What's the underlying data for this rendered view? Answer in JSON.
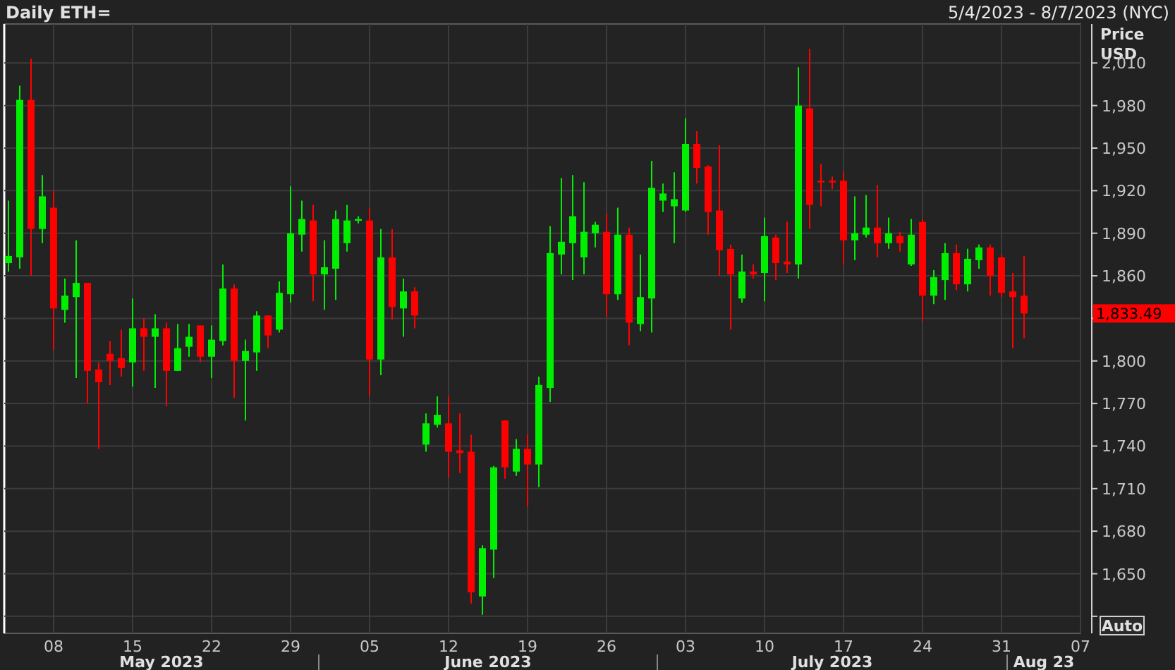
{
  "header": {
    "title": "Daily ETH=",
    "date_range": "5/4/2023 - 8/7/2023 (NYC)"
  },
  "price_axis": {
    "title": "Price",
    "unit": "USD",
    "last_price": "1,833.49",
    "auto_button": "Auto"
  },
  "months": [
    "May 2023",
    "June 2023",
    "July 2023",
    "Aug 23"
  ],
  "chart_data": {
    "type": "candlestick",
    "xlim": [
      "2023-05-04",
      "2023-08-07"
    ],
    "ylim": [
      1608,
      2037.5
    ],
    "yticks": [
      {
        "value": 2010,
        "label": "2,010"
      },
      {
        "value": 1980,
        "label": "1,980"
      },
      {
        "value": 1950,
        "label": "1,950"
      },
      {
        "value": 1920,
        "label": "1,920"
      },
      {
        "value": 1890,
        "label": "1,890"
      },
      {
        "value": 1860,
        "label": "1,860"
      },
      {
        "value": 1800,
        "label": "1,800"
      },
      {
        "value": 1770,
        "label": "1,770"
      },
      {
        "value": 1740,
        "label": "1,740"
      },
      {
        "value": 1710,
        "label": "1,710"
      },
      {
        "value": 1680,
        "label": "1,680"
      },
      {
        "value": 1650,
        "label": "1,650"
      }
    ],
    "xticks": [
      {
        "value": "2023-05-08",
        "label": "08"
      },
      {
        "value": "2023-05-15",
        "label": "15"
      },
      {
        "value": "2023-05-22",
        "label": "22"
      },
      {
        "value": "2023-05-29",
        "label": "29"
      },
      {
        "value": "2023-06-05",
        "label": "05"
      },
      {
        "value": "2023-06-12",
        "label": "12"
      },
      {
        "value": "2023-06-19",
        "label": "19"
      },
      {
        "value": "2023-06-26",
        "label": "26"
      },
      {
        "value": "2023-07-03",
        "label": "03"
      },
      {
        "value": "2023-07-10",
        "label": "10"
      },
      {
        "value": "2023-07-17",
        "label": "17"
      },
      {
        "value": "2023-07-24",
        "label": "24"
      },
      {
        "value": "2023-07-31",
        "label": "31"
      },
      {
        "value": "2023-08-07",
        "label": "07"
      }
    ],
    "x": [
      "2023-05-04",
      "2023-05-05",
      "2023-05-06",
      "2023-05-07",
      "2023-05-08",
      "2023-05-09",
      "2023-05-10",
      "2023-05-11",
      "2023-05-12",
      "2023-05-13",
      "2023-05-14",
      "2023-05-15",
      "2023-05-16",
      "2023-05-17",
      "2023-05-18",
      "2023-05-19",
      "2023-05-20",
      "2023-05-21",
      "2023-05-22",
      "2023-05-23",
      "2023-05-24",
      "2023-05-25",
      "2023-05-26",
      "2023-05-27",
      "2023-05-28",
      "2023-05-29",
      "2023-05-30",
      "2023-05-31",
      "2023-06-01",
      "2023-06-02",
      "2023-06-03",
      "2023-06-04",
      "2023-06-05",
      "2023-06-06",
      "2023-06-07",
      "2023-06-08",
      "2023-06-09",
      "2023-06-10",
      "2023-06-11",
      "2023-06-12",
      "2023-06-13",
      "2023-06-14",
      "2023-06-15",
      "2023-06-16",
      "2023-06-17",
      "2023-06-18",
      "2023-06-19",
      "2023-06-20",
      "2023-06-21",
      "2023-06-22",
      "2023-06-23",
      "2023-06-24",
      "2023-06-25",
      "2023-06-26",
      "2023-06-27",
      "2023-06-28",
      "2023-06-29",
      "2023-06-30",
      "2023-07-01",
      "2023-07-02",
      "2023-07-03",
      "2023-07-04",
      "2023-07-05",
      "2023-07-06",
      "2023-07-07",
      "2023-07-08",
      "2023-07-09",
      "2023-07-10",
      "2023-07-11",
      "2023-07-12",
      "2023-07-13",
      "2023-07-14",
      "2023-07-15",
      "2023-07-16",
      "2023-07-17",
      "2023-07-18",
      "2023-07-19",
      "2023-07-20",
      "2023-07-21",
      "2023-07-22",
      "2023-07-23",
      "2023-07-24",
      "2023-07-25",
      "2023-07-26",
      "2023-07-27",
      "2023-07-28",
      "2023-07-29",
      "2023-07-30",
      "2023-07-31",
      "2023-08-01",
      "2023-08-02"
    ],
    "ohlc": [
      [
        1869,
        1913,
        1863,
        1874
      ],
      [
        1873,
        1994,
        1865,
        1984
      ],
      [
        1984,
        2013,
        1860,
        1893
      ],
      [
        1893,
        1931,
        1883,
        1916
      ],
      [
        1908,
        1920,
        1808,
        1837
      ],
      [
        1836,
        1858,
        1827,
        1846
      ],
      [
        1845,
        1885,
        1788,
        1855
      ],
      [
        1855,
        1855,
        1770,
        1793
      ],
      [
        1794,
        1799,
        1738,
        1785
      ],
      [
        1805,
        1814,
        1783,
        1800
      ],
      [
        1802,
        1822,
        1789,
        1795
      ],
      [
        1799,
        1844,
        1782,
        1823
      ],
      [
        1823,
        1830,
        1793,
        1817
      ],
      [
        1817,
        1833,
        1781,
        1823
      ],
      [
        1823,
        1827,
        1768,
        1793
      ],
      [
        1793,
        1826,
        1793,
        1809
      ],
      [
        1810,
        1826,
        1803,
        1817
      ],
      [
        1825,
        1825,
        1799,
        1803
      ],
      [
        1803,
        1825,
        1788,
        1815
      ],
      [
        1814,
        1868,
        1811,
        1851
      ],
      [
        1851,
        1854,
        1774,
        1800
      ],
      [
        1800,
        1815,
        1758,
        1807
      ],
      [
        1806,
        1835,
        1793,
        1832
      ],
      [
        1832,
        1832,
        1809,
        1818
      ],
      [
        1822,
        1856,
        1820,
        1848
      ],
      [
        1847,
        1923,
        1841,
        1890
      ],
      [
        1889,
        1913,
        1877,
        1900
      ],
      [
        1899,
        1910,
        1842,
        1861
      ],
      [
        1861,
        1885,
        1836,
        1866
      ],
      [
        1865,
        1906,
        1843,
        1900
      ],
      [
        1883,
        1910,
        1877,
        1899
      ],
      [
        1899,
        1902,
        1897,
        1900
      ],
      [
        1899,
        1908,
        1775,
        1801
      ],
      [
        1801,
        1893,
        1790,
        1873
      ],
      [
        1873,
        1893,
        1829,
        1838
      ],
      [
        1837,
        1858,
        1817,
        1849
      ],
      [
        1849,
        1852,
        1823,
        1832
      ],
      [
        1741,
        1763,
        1736,
        1756
      ],
      [
        1755,
        1775,
        1753,
        1762
      ],
      [
        1756,
        1775,
        1718,
        1736
      ],
      [
        1737,
        1763,
        1721,
        1735
      ],
      [
        1736,
        1748,
        1629,
        1637
      ],
      [
        1634,
        1670,
        1621,
        1668
      ],
      [
        1667,
        1726,
        1647,
        1725
      ],
      [
        1758,
        1758,
        1717,
        1725
      ],
      [
        1722,
        1745,
        1719,
        1738
      ],
      [
        1738,
        1748,
        1697,
        1727
      ],
      [
        1727,
        1789,
        1711,
        1783
      ],
      [
        1781,
        1895,
        1771,
        1876
      ],
      [
        1875,
        1929,
        1861,
        1884
      ],
      [
        1883,
        1931,
        1857,
        1902
      ],
      [
        1873,
        1926,
        1861,
        1891
      ],
      [
        1890,
        1898,
        1880,
        1896
      ],
      [
        1891,
        1904,
        1831,
        1847
      ],
      [
        1847,
        1908,
        1843,
        1889
      ],
      [
        1889,
        1894,
        1811,
        1827
      ],
      [
        1826,
        1875,
        1821,
        1845
      ],
      [
        1844,
        1941,
        1820,
        1922
      ],
      [
        1913,
        1925,
        1905,
        1918
      ],
      [
        1909,
        1933,
        1883,
        1914
      ],
      [
        1906,
        1971,
        1905,
        1953
      ],
      [
        1953,
        1962,
        1925,
        1936
      ],
      [
        1937,
        1938,
        1889,
        1905
      ],
      [
        1906,
        1952,
        1860,
        1878
      ],
      [
        1879,
        1882,
        1822,
        1861
      ],
      [
        1844,
        1875,
        1841,
        1863
      ],
      [
        1863,
        1868,
        1858,
        1861
      ],
      [
        1862,
        1901,
        1842,
        1888
      ],
      [
        1887,
        1889,
        1857,
        1869
      ],
      [
        1870,
        1898,
        1862,
        1868
      ],
      [
        1868,
        2007,
        1858,
        1980
      ],
      [
        1978,
        2020,
        1893,
        1910
      ],
      [
        1927,
        1939,
        1909,
        1926
      ],
      [
        1927,
        1930,
        1921,
        1926
      ],
      [
        1927,
        1933,
        1868,
        1885
      ],
      [
        1885,
        1916,
        1871,
        1890
      ],
      [
        1889,
        1917,
        1887,
        1894
      ],
      [
        1894,
        1924,
        1873,
        1883
      ],
      [
        1883,
        1901,
        1879,
        1890
      ],
      [
        1888,
        1891,
        1877,
        1883
      ],
      [
        1868,
        1900,
        1867,
        1889
      ],
      [
        1898,
        1900,
        1828,
        1846
      ],
      [
        1846,
        1864,
        1840,
        1859
      ],
      [
        1857,
        1883,
        1843,
        1876
      ],
      [
        1876,
        1882,
        1850,
        1854
      ],
      [
        1854,
        1879,
        1849,
        1872
      ],
      [
        1871,
        1882,
        1865,
        1880
      ],
      [
        1880,
        1882,
        1846,
        1860
      ],
      [
        1873,
        1875,
        1845,
        1848
      ],
      [
        1849,
        1862,
        1809,
        1845
      ],
      [
        1846,
        1874,
        1816,
        1833.49
      ]
    ]
  }
}
